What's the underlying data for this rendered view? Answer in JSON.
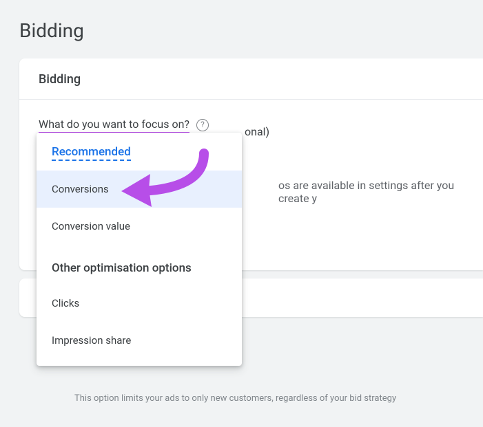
{
  "page": {
    "title": "Bidding"
  },
  "card": {
    "header": "Bidding",
    "question": "What do you want to focus on?",
    "optional_fragment": "onal)",
    "settings_hint_fragment": "os are available in settings after you create y"
  },
  "dropdown": {
    "recommended_label": "Recommended",
    "other_label": "Other optimisation options",
    "items": [
      {
        "label": "Conversions",
        "selected": true
      },
      {
        "label": "Conversion value",
        "selected": false
      },
      {
        "label": "Clicks",
        "selected": false
      },
      {
        "label": "Impression share",
        "selected": false
      }
    ]
  },
  "footer": {
    "hint": "This option limits your ads to only new customers, regardless of your bid strategy"
  },
  "colors": {
    "highlight": "#b74ee8",
    "link": "#1a73e8",
    "selected_bg": "#e8f0fe"
  }
}
